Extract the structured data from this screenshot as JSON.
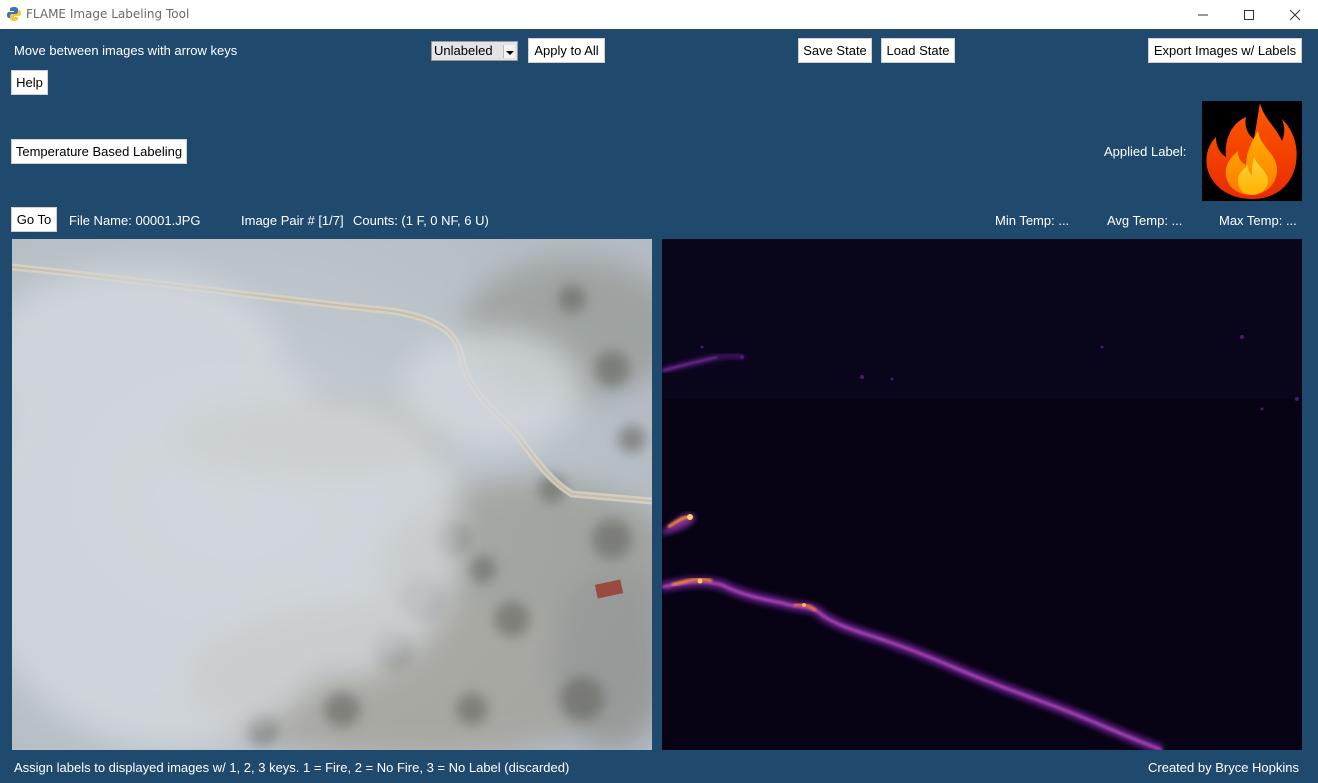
{
  "window": {
    "title": "FLAME Image Labeling Tool"
  },
  "top": {
    "instructions": "Move between images with arrow keys",
    "label_select_value": "Unlabeled",
    "apply_all_label": "Apply to All",
    "save_state_label": "Save State",
    "load_state_label": "Load State",
    "export_label": "Export Images w/ Labels",
    "help_label": "Help",
    "temp_labeling_label": "Temperature Based Labeling",
    "applied_label_text": "Applied Label:"
  },
  "info": {
    "goto_label": "Go To",
    "file_name": "File Name: 00001.JPG",
    "image_pair": "Image Pair # [1/7]",
    "counts": "Counts: (1 F, 0 NF, 6 U)",
    "min_temp": "Min Temp: ...",
    "avg_temp": "Avg Temp: ...",
    "max_temp": "Max Temp: ..."
  },
  "footer": {
    "assign_hint": "Assign labels to displayed images w/ 1, 2, 3 keys. 1 = Fire, 2 = No Fire, 3 = No Label (discarded)",
    "credit": "Created by Bryce Hopkins"
  },
  "colors": {
    "background": "#1f4a6e",
    "button_bg": "#ffffff",
    "fire_orange": "#ff6a00",
    "thermal_bg": "#070314"
  },
  "icons": {
    "app": "python-icon",
    "applied_label": "fire-icon"
  }
}
